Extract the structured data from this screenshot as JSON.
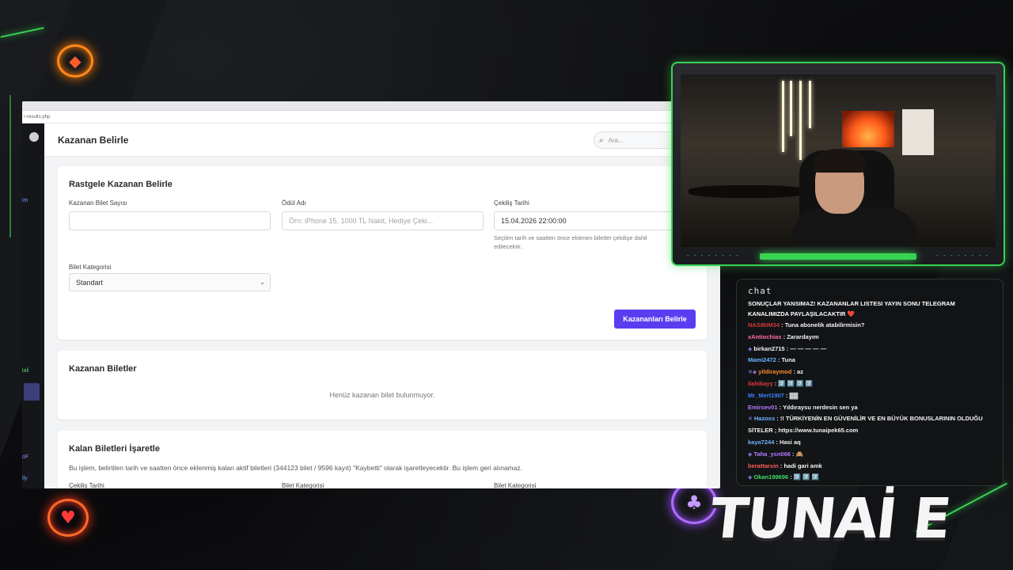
{
  "browser": {
    "url_fragment": "r-results.php",
    "icons": "🔍"
  },
  "sidebar": {
    "fragments": [
      "im",
      "lali",
      "oF",
      "lly"
    ]
  },
  "header": {
    "title": "Kazanan Belirle",
    "search_placeholder": "Ara..."
  },
  "random_winner": {
    "title": "Rastgele Kazanan Belirle",
    "ticket_count_label": "Kazanan Bilet Sayısı",
    "ticket_count_value": "",
    "prize_label": "Ödül Adı",
    "prize_placeholder": "Örn: iPhone 15, 1000 TL Nakit, Hediye Çeki...",
    "draw_date_label": "Çekiliş Tarihi",
    "draw_date_value": "15.04.2026 22:00:00",
    "draw_date_help_1": "Seçilen tarih ve saatten önce eklenen biletler çekilişe dahil",
    "draw_date_help_2": "edilecektir.",
    "category_label": "Bilet Kategorisi",
    "category_value": "Standart",
    "submit_label": "Kazananları Belirle"
  },
  "winning_tickets": {
    "title": "Kazanan Biletler",
    "empty_message": "Henüz kazanan bilet bulunmuyor."
  },
  "mark_remaining": {
    "title": "Kalan Biletleri İşaretle",
    "description": "Bu işlem, belirtilen tarih ve saatten önce eklenmiş kalan aktif biletleri (344123 bilet / 9596 kayıt) \"Kaybetti\" olarak işaretleyecektir. Bu işlem geri alınamaz.",
    "col1_label": "Çekiliş Tarihi",
    "col2_label": "Bilet Kategorisi",
    "col3_label": "Bilet Kategorisi"
  },
  "chat": {
    "title": "chat",
    "pinned": "SONUÇLAR YANSIMAZ! KAZANANLAR LISTESI YAYIN SONU TELEGRAM KANALIMIZDA PAYLAŞILACAKTIR ❤️",
    "messages": [
      {
        "user": "NASIBIM34",
        "color": "#d4383c",
        "text": "Tuna abonelik atabilirmisin?",
        "badge": ""
      },
      {
        "user": "xAntiochiax",
        "color": "#ff6ea0",
        "text": "Zarardayım",
        "badge": ""
      },
      {
        "user": "birkan2715",
        "color": "#f2f2f2",
        "text": "—  —  —  —  —",
        "badge": "◈"
      },
      {
        "user": "Mami2472",
        "color": "#6fb3ff",
        "text": "Tuna",
        "badge": ""
      },
      {
        "user": "yildiraymod",
        "color": "#ff8c2a",
        "text": "az",
        "badge": "✕◈"
      },
      {
        "user": "ilahikayy",
        "color": "#e23a3a",
        "text": "7️⃣  7️⃣  7️⃣  7️⃣",
        "badge": ""
      },
      {
        "user": "Mr_Mert1907",
        "color": "#3f7cff",
        "text": "▓▓",
        "badge": ""
      },
      {
        "user": "Emirsev01",
        "color": "#b47cff",
        "text": "Yıldıraysu nerdesin sen ya",
        "badge": ""
      },
      {
        "user": "Hazoxs",
        "color": "#6fb3ff",
        "text": "!! TÜRKİYENİN EN GÜVENİLİR VE EN BÜYÜK BONUSLARININ OLDUĞU",
        "badge": "✕"
      },
      {
        "user": "",
        "color": "#f2f2f2",
        "text": "SİTELER ; https://www.tunaipek65.com",
        "badge": ""
      },
      {
        "user": "kaya7244",
        "color": "#6fb3ff",
        "text": "Hasi aq",
        "badge": ""
      },
      {
        "user": "Taha_ysn066",
        "color": "#b47cff",
        "text": "🙈",
        "badge": "◈"
      },
      {
        "user": "berattarsin",
        "color": "#ff5a5a",
        "text": "hadi gari amk",
        "badge": ""
      },
      {
        "user": "Okan199696",
        "color": "#3fdc6a",
        "text": "7️⃣  7️⃣  7️⃣",
        "badge": "◈"
      }
    ]
  },
  "brand": {
    "logo_text": "TUNAİ E"
  },
  "colors": {
    "accent_green": "#39d353",
    "primary_button": "#5b3df0"
  }
}
